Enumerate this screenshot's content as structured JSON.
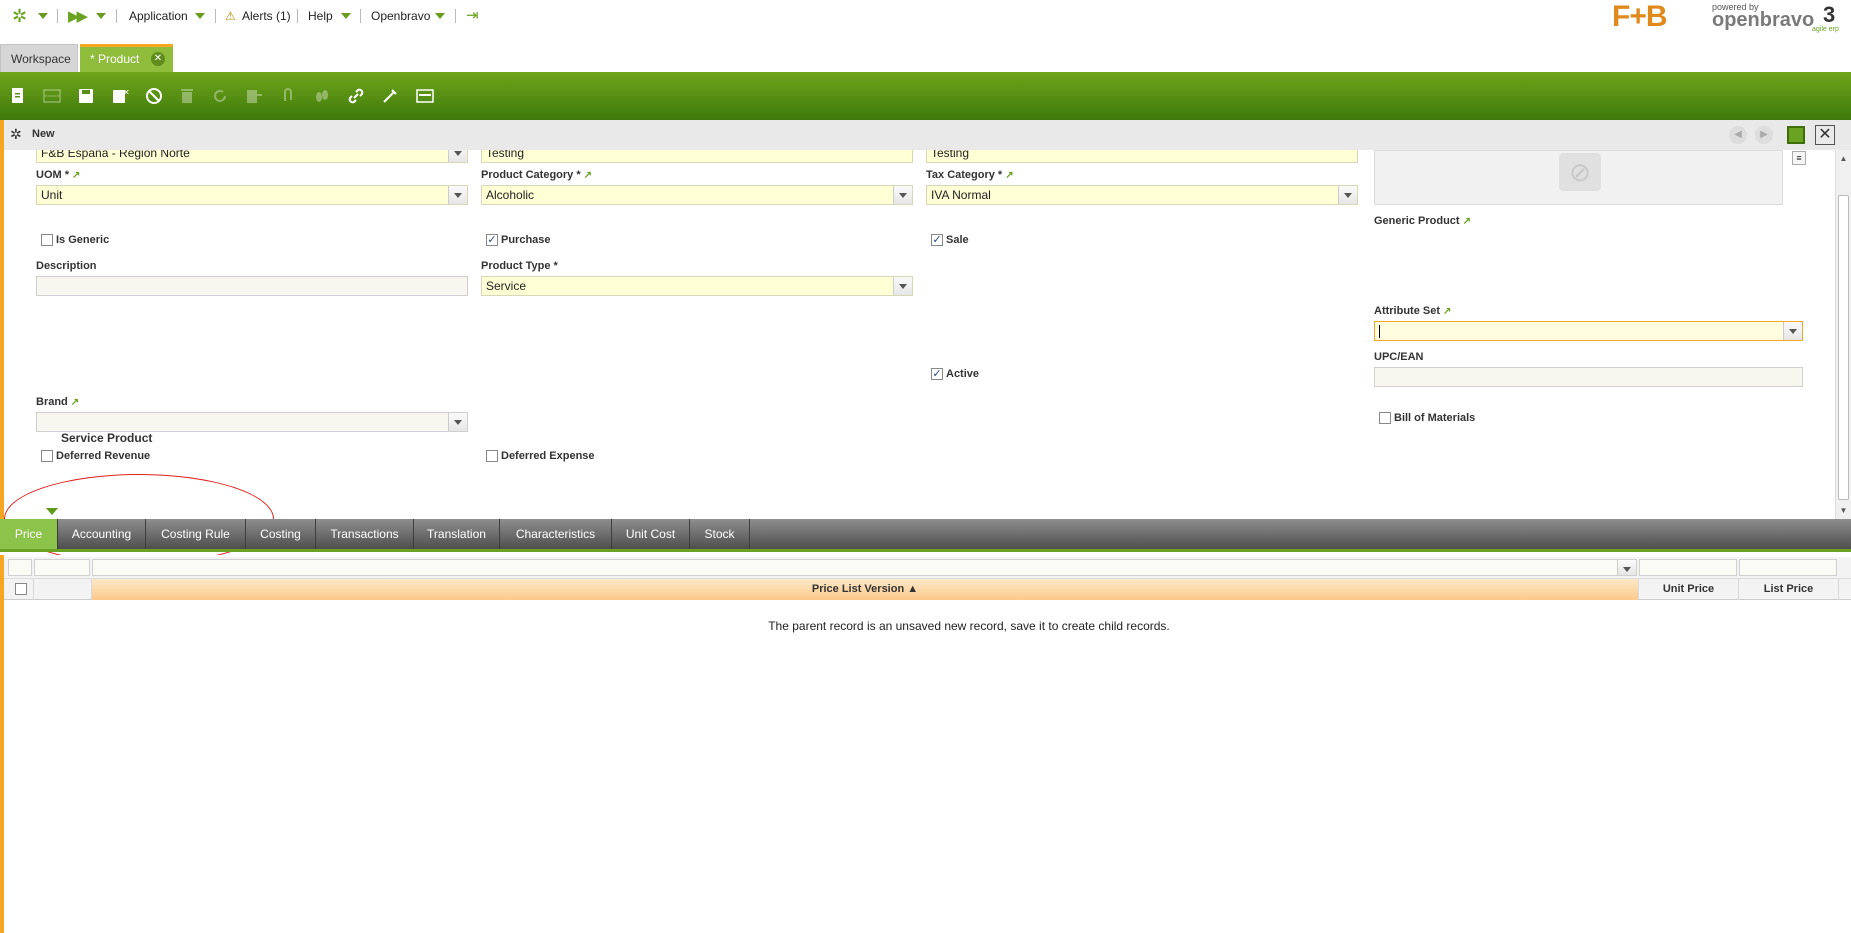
{
  "topbar": {
    "application": "Application",
    "alerts": "Alerts (1)",
    "help": "Help",
    "user": "Openbravo"
  },
  "brand": {
    "logo": "F+B",
    "powered_by": "powered by",
    "product": "openbravo",
    "version": "3",
    "tagline": "agile erp"
  },
  "window_tabs": {
    "workspace": "Workspace",
    "product": "* Product"
  },
  "form_header": {
    "status": "New"
  },
  "form": {
    "row0": {
      "organization": "F&B España - Región Norte",
      "search_key": "Testing",
      "name": "Testing"
    },
    "uom": {
      "label": "UOM *",
      "value": "Unit"
    },
    "product_category": {
      "label": "Product Category *",
      "value": "Alcoholic"
    },
    "tax_category": {
      "label": "Tax Category *",
      "value": "IVA Normal"
    },
    "generic_product": {
      "label": "Generic Product"
    },
    "is_generic": {
      "label": "Is Generic",
      "checked": false
    },
    "purchase": {
      "label": "Purchase",
      "checked": true
    },
    "sale": {
      "label": "Sale",
      "checked": true
    },
    "description": {
      "label": "Description",
      "value": ""
    },
    "product_type": {
      "label": "Product Type *",
      "value": "Service"
    },
    "attribute_set": {
      "label": "Attribute Set",
      "value": ""
    },
    "upc": {
      "label": "UPC/EAN",
      "value": ""
    },
    "active": {
      "label": "Active",
      "checked": true
    },
    "brand": {
      "label": "Brand",
      "value": ""
    },
    "bill_of_materials": {
      "label": "Bill of Materials",
      "checked": false
    },
    "deferred_revenue": {
      "label": "Deferred Revenue",
      "checked": false
    },
    "deferred_expense": {
      "label": "Deferred Expense",
      "checked": false
    },
    "section": "Service Product"
  },
  "child_tabs": [
    "Price",
    "Accounting",
    "Costing Rule",
    "Costing",
    "Transactions",
    "Translation",
    "Characteristics",
    "Unit Cost",
    "Stock"
  ],
  "grid": {
    "columns": [
      "Price List Version ▲",
      "Unit Price",
      "List Price"
    ],
    "empty_message": "The parent record is an unsaved new record, save it to create child records."
  }
}
